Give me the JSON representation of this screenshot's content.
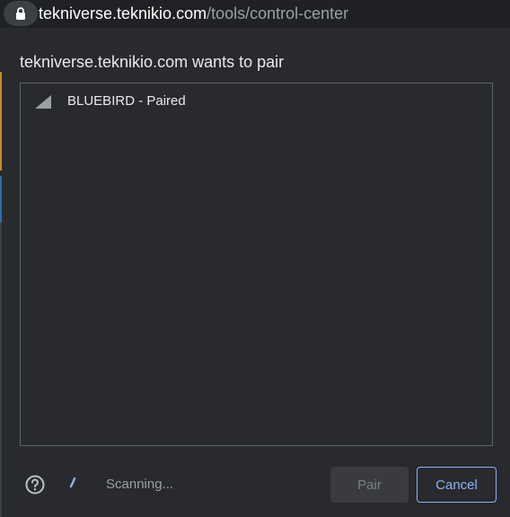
{
  "urlbar": {
    "host": "tekniverse.teknikio.com",
    "path": "/tools/control-center",
    "lock_icon": "lock-icon"
  },
  "dialog": {
    "title": "tekniverse.teknikio.com wants to pair",
    "devices": [
      {
        "label": "BLUEBIRD - Paired",
        "icon": "signal-strength-icon"
      }
    ],
    "status": "Scanning...",
    "help_icon": "help-circle-icon",
    "pair_label": "Pair",
    "cancel_label": "Cancel"
  },
  "colors": {
    "background": "#292a2d",
    "text": "#e8eaed",
    "muted_text": "#9aa0a6",
    "accent": "#8ab4f8",
    "border": "#5f6368"
  }
}
